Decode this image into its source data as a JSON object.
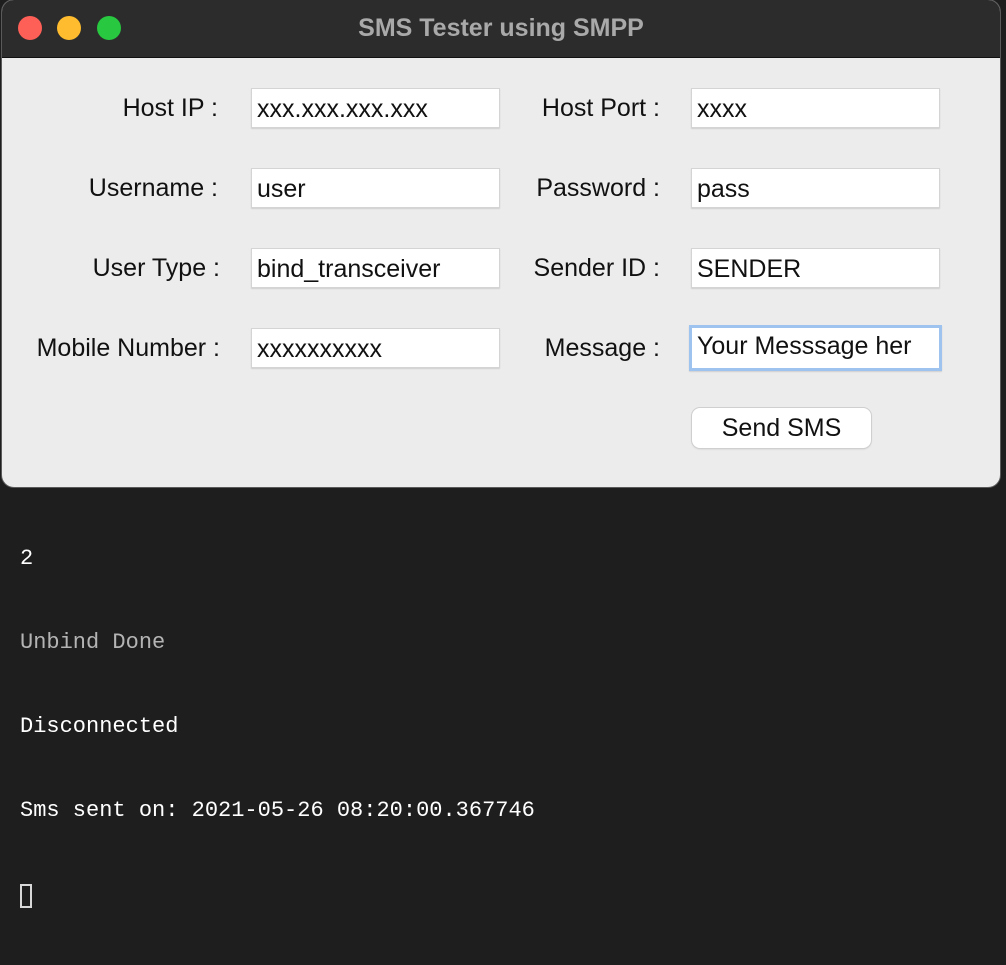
{
  "window": {
    "title": "SMS Tester using SMPP"
  },
  "form": {
    "host_ip": {
      "label": "Host IP :",
      "value": "xxx.xxx.xxx.xxx"
    },
    "host_port": {
      "label": "Host Port :",
      "value": "xxxx"
    },
    "username": {
      "label": "Username :",
      "value": "user"
    },
    "password": {
      "label": "Password :",
      "value": "pass"
    },
    "user_type": {
      "label": "User Type :",
      "value": "bind_transceiver"
    },
    "sender_id": {
      "label": "Sender ID :",
      "value": "SENDER"
    },
    "mobile_number": {
      "label": "Mobile Number :",
      "value": "xxxxxxxxxx"
    },
    "message": {
      "label": "Message :",
      "value": "Your Messsage her"
    },
    "send_label": "Send SMS"
  },
  "terminal": {
    "lines": [
      "2",
      "Unbind Done",
      "Disconnected",
      "Sms sent on: 2021-05-26 08:20:00.367746"
    ]
  },
  "colors": {
    "close": "#fe5f57",
    "minimize": "#febc2e",
    "maximize": "#28c840",
    "focus_ring": "#9ec3ee"
  }
}
